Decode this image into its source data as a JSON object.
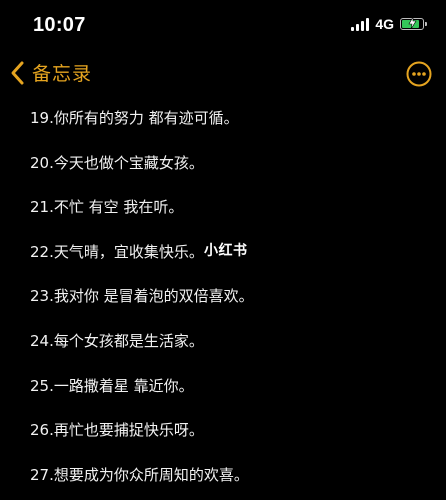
{
  "status_bar": {
    "time": "10:07",
    "network": "4G",
    "battery_level": 0.85,
    "battery_color": "#34c759"
  },
  "nav": {
    "back_label": "备忘录",
    "back_icon": "chevron-left-icon",
    "more_icon": "ellipsis-circle-icon",
    "accent_color": "#e5a420"
  },
  "note": {
    "lines": [
      "19.你所有的努力 都有迹可循。",
      "20.今天也做个宝藏女孩。",
      "21.不忙 有空 我在听。",
      "22.天气晴，宜收集快乐。",
      "23.我对你 是冒着泡的双倍喜欢。",
      "24.每个女孩都是生活家。",
      "25.一路撒着星 靠近你。",
      "26.再忙也要捕捉快乐呀。",
      "27.想要成为你众所周知的欢喜。"
    ]
  },
  "watermark": "小红书"
}
